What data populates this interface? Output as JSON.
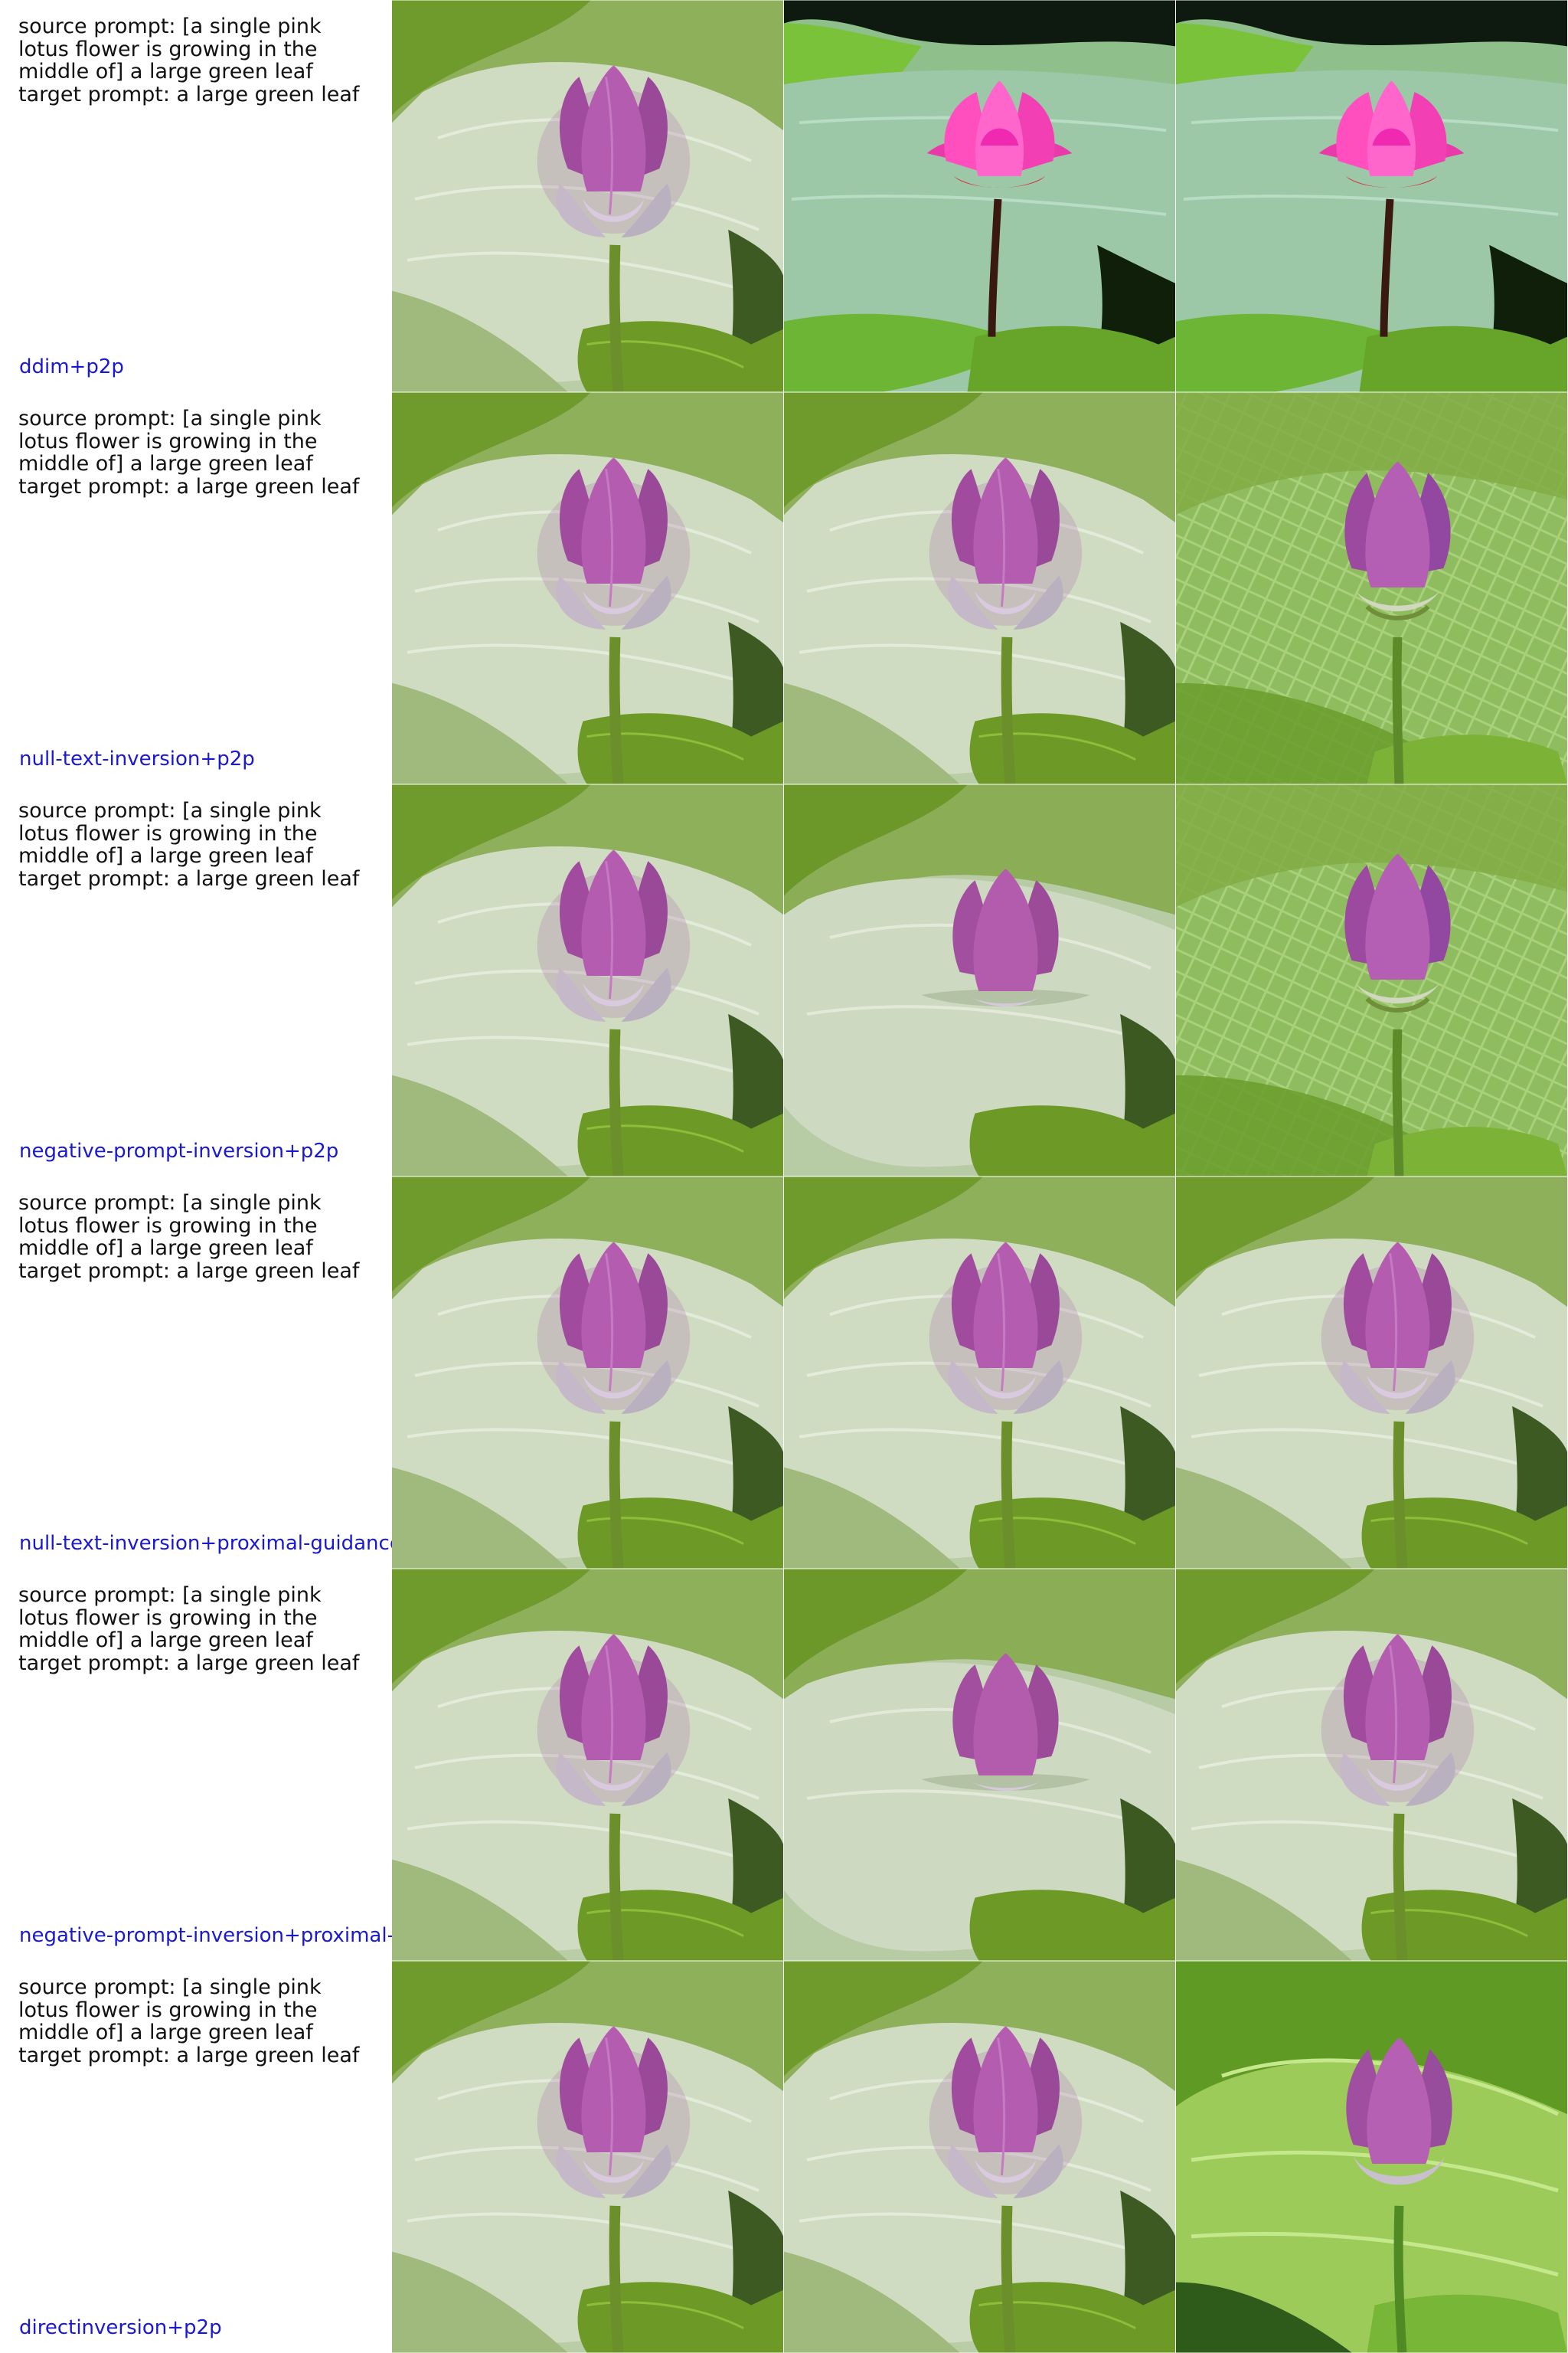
{
  "rows": [
    {
      "source_prompt": "source prompt: [a single pink lotus flower is growing in the middle of] a large green leaf",
      "target_prompt": "target prompt: a large green leaf",
      "method": "ddim+p2p"
    },
    {
      "source_prompt": "source prompt: [a single pink lotus flower is growing in the middle of] a large green leaf",
      "target_prompt": "target prompt: a large green leaf",
      "method": "null-text-inversion+p2p"
    },
    {
      "source_prompt": "source prompt: [a single pink lotus flower is growing in the middle of] a large green leaf",
      "target_prompt": "target prompt: a large green leaf",
      "method": "negative-prompt-inversion+p2p"
    },
    {
      "source_prompt": "source prompt: [a single pink lotus flower is growing in the middle of] a large green leaf",
      "target_prompt": "target prompt: a large green leaf",
      "method": "null-text-inversion+proximal-guidance"
    },
    {
      "source_prompt": "source prompt: [a single pink lotus flower is growing in the middle of] a large green leaf",
      "target_prompt": "target prompt: a large green leaf",
      "method": "negative-prompt-inversion+proximal-guidance"
    },
    {
      "source_prompt": "source prompt: [a single pink lotus flower is growing in the middle of] a large green leaf",
      "target_prompt": "target prompt: a large green leaf",
      "method": "directinversion+p2p"
    }
  ],
  "colors": {
    "method_label": "#1a18d4",
    "caption_text": "#111111",
    "leaf_light": "#c8d8b8",
    "leaf_dark": "#4f7a1c",
    "lotus_pink": "#b54fb0",
    "lotus_bright": "#f01fb8"
  }
}
